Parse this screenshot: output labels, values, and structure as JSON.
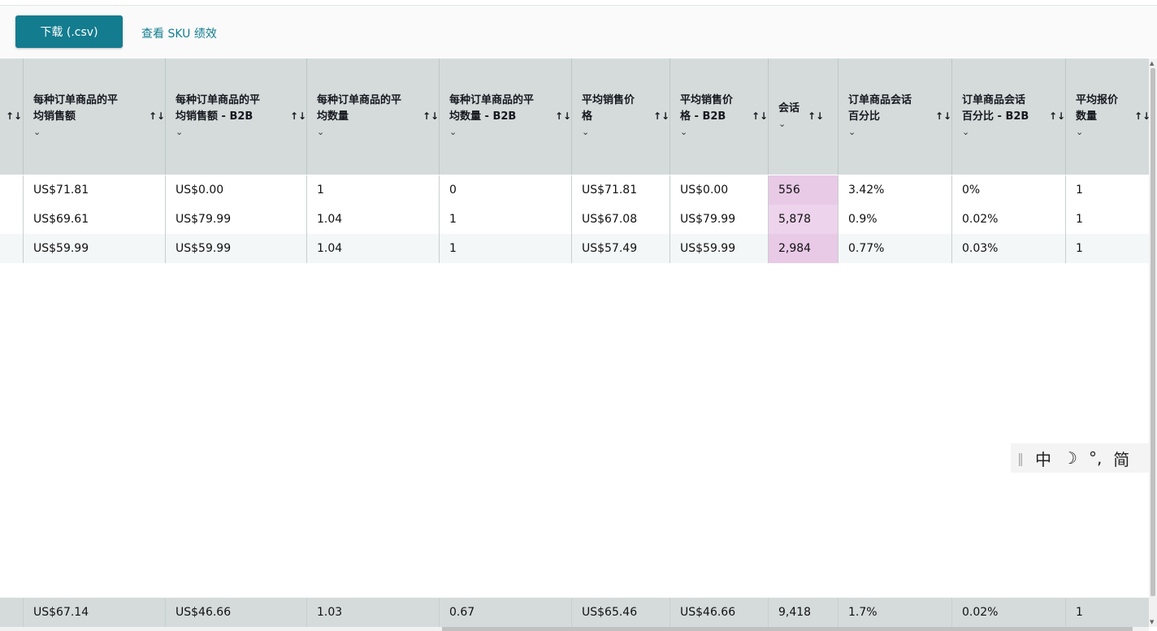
{
  "toolbar": {
    "download_label": "下载 (.csv)",
    "sku_link": "查看 SKU 绩效"
  },
  "table": {
    "sort_icon": "↑↓",
    "chevron": "⌄",
    "headers": [
      {
        "id": "avg-sales-per-item",
        "line1": "每种订单商品的平",
        "line2": "均销售额"
      },
      {
        "id": "avg-sales-per-item-b2b",
        "line1": "每种订单商品的平",
        "line2": "均销售额 - B2B"
      },
      {
        "id": "avg-units-per-item",
        "line1": "每种订单商品的平",
        "line2": "均数量"
      },
      {
        "id": "avg-units-per-item-b2b",
        "line1": "每种订单商品的平",
        "line2": "均数量 - B2B"
      },
      {
        "id": "avg-selling-price",
        "line1": "平均销售价",
        "line2": "格"
      },
      {
        "id": "avg-selling-price-b2b",
        "line1": "平均销售价",
        "line2": "格 - B2B"
      },
      {
        "id": "sessions",
        "line1": "会话",
        "line2": ""
      },
      {
        "id": "unit-session-pct",
        "line1": "订单商品会话",
        "line2": "百分比"
      },
      {
        "id": "unit-session-pct-b2b",
        "line1": "订单商品会话",
        "line2": "百分比 - B2B"
      },
      {
        "id": "avg-offer-count",
        "line1": "平均报价",
        "line2": "数量"
      }
    ],
    "rows": [
      [
        "US$71.81",
        "US$0.00",
        "1",
        "0",
        "US$71.81",
        "US$0.00",
        "556",
        "3.42%",
        "0%",
        "1"
      ],
      [
        "US$69.61",
        "US$79.99",
        "1.04",
        "1",
        "US$67.08",
        "US$79.99",
        "5,878",
        "0.9%",
        "0.02%",
        "1"
      ],
      [
        "US$59.99",
        "US$59.99",
        "1.04",
        "1",
        "US$57.49",
        "US$59.99",
        "2,984",
        "0.77%",
        "0.03%",
        "1"
      ]
    ],
    "totals": [
      "US$67.14",
      "US$46.66",
      "1.03",
      "0.67",
      "US$65.46",
      "US$46.66",
      "9,418",
      "1.7%",
      "0.02%",
      "1"
    ]
  },
  "ime": {
    "mode": "中",
    "moon": "☽",
    "punct": "°,",
    "script": "简"
  },
  "colors": {
    "accent": "#147c8f",
    "header_bg": "#d5dbdb",
    "session_highlight": "#e8c9e6"
  }
}
